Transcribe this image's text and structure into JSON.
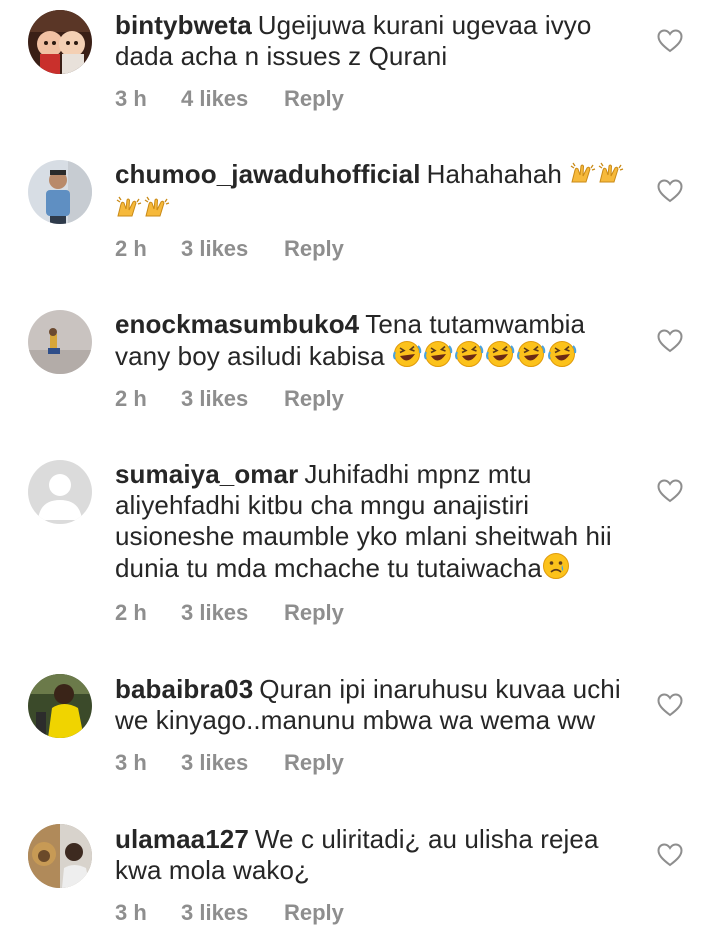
{
  "comments": [
    {
      "username": "bintybweta",
      "text": "Ugeijuwa kurani ugevaa ivyo dada acha n issues z Qurani",
      "emoji_names": [],
      "time": "3 h",
      "likes": "4 likes",
      "reply": "Reply",
      "avatar_icon": "profile-photo"
    },
    {
      "username": "chumoo_jawaduhofficial",
      "text": "Hahahahah",
      "emoji_names": [
        "raising-hands-emoji",
        "raising-hands-emoji",
        "raising-hands-emoji",
        "raising-hands-emoji"
      ],
      "time": "2 h",
      "likes": "3 likes",
      "reply": "Reply",
      "avatar_icon": "profile-photo"
    },
    {
      "username": "enockmasumbuko4",
      "text": "Tena tutamwambia vany boy asiludi kabisa",
      "emoji_names": [
        "rolling-laughing-emoji",
        "rolling-laughing-emoji",
        "rolling-laughing-emoji",
        "rolling-laughing-emoji",
        "rolling-laughing-emoji",
        "rolling-laughing-emoji"
      ],
      "time": "2 h",
      "likes": "3 likes",
      "reply": "Reply",
      "avatar_icon": "profile-photo"
    },
    {
      "username": "sumaiya_omar",
      "text": "Juhifadhi mpnz mtu aliyehfadhi kitbu cha mngu anajistiri usioneshe maumble yko mlani sheitwah hii dunia tu mda mchache tu tutaiwacha",
      "emoji_names": [
        "crying-emoji"
      ],
      "time": "2 h",
      "likes": "3 likes",
      "reply": "Reply",
      "avatar_icon": "default-avatar-icon"
    },
    {
      "username": "babaibra03",
      "text": "Quran ipi inaruhusu kuvaa uchi we kinyago..manunu mbwa wa wema ww",
      "emoji_names": [],
      "time": "3 h",
      "likes": "3 likes",
      "reply": "Reply",
      "avatar_icon": "profile-photo"
    },
    {
      "username": "ulamaa127",
      "text": "We c uliritadi¿ au ulisha rejea kwa mola wako¿",
      "emoji_names": [],
      "time": "3 h",
      "likes": "3 likes",
      "reply": "Reply",
      "avatar_icon": "profile-photo"
    }
  ],
  "icons": {
    "like": "heart-outline-icon"
  },
  "colors": {
    "text": "#262626",
    "meta": "#8e8e8e",
    "heart": "#8e8e8e"
  }
}
